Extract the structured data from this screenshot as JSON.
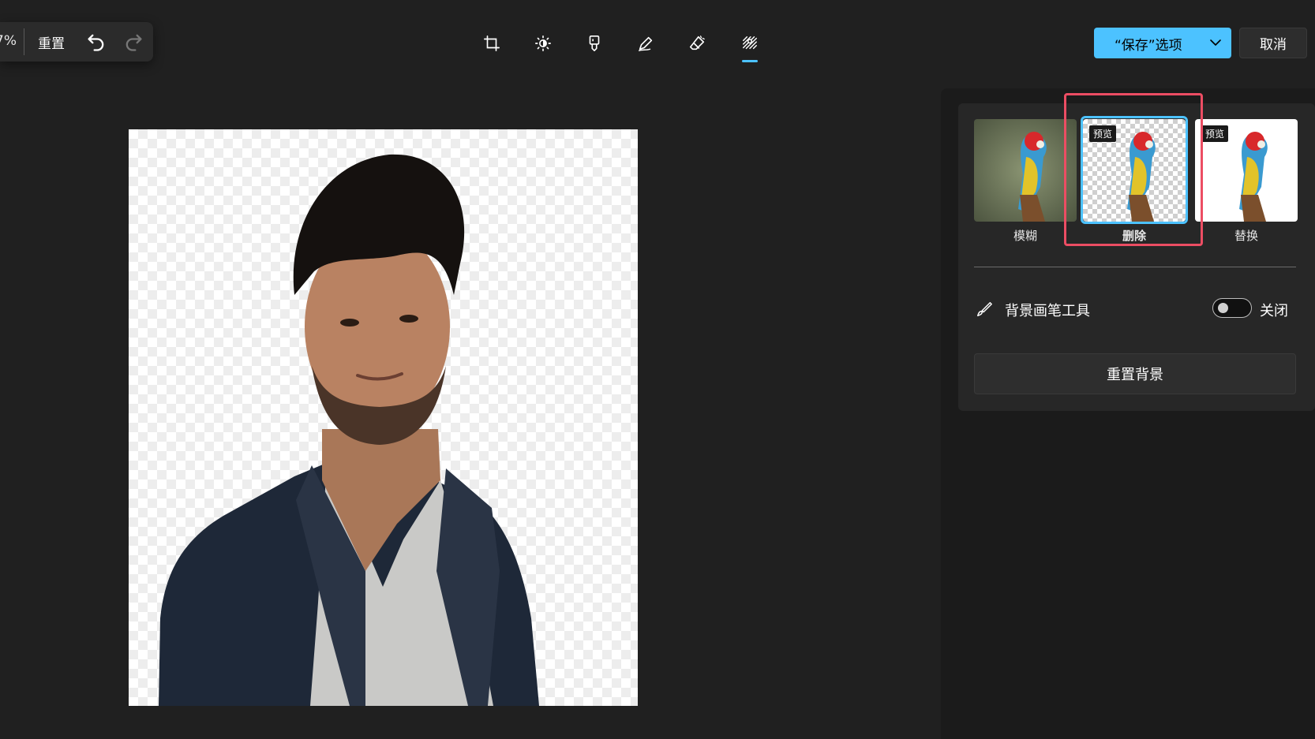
{
  "top_left": {
    "zoom_text": "7%",
    "reset_label": "重置"
  },
  "toolbar": {
    "tools": [
      "crop-icon",
      "brightness-icon",
      "marker-icon",
      "pen-icon",
      "eraser-icon",
      "background-icon"
    ],
    "active_tool": "background-icon"
  },
  "actions": {
    "save_label": "“保存”选项",
    "cancel_label": "取消",
    "accent_color": "#4cc2ff"
  },
  "background_panel": {
    "options": [
      {
        "label": "模糊",
        "badge": ""
      },
      {
        "label": "删除",
        "badge": "预览"
      },
      {
        "label": "替换",
        "badge": "预览"
      }
    ],
    "selected_option": "删除",
    "brush_tool_label": "背景画笔工具",
    "toggle_state_label": "关闭",
    "reset_background_label": "重置背景",
    "highlight_color": "#ec4d63"
  }
}
